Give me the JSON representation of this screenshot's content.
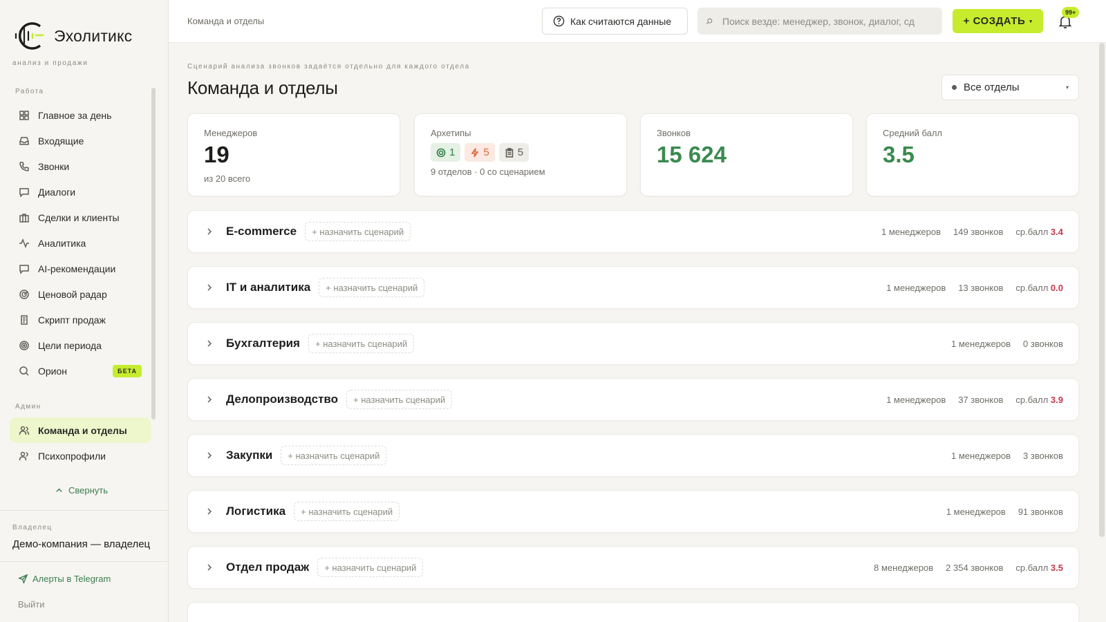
{
  "app": {
    "name": "Эхолитикс",
    "tagline": "анализ и продажи",
    "colors": {
      "accent": "#c6ec2d",
      "green": "#3a8a4f",
      "score_red": "#c8364b"
    }
  },
  "sidebar": {
    "work_label": "Работа",
    "work_items": [
      {
        "label": "Главное за день",
        "icon": "dashboard-icon"
      },
      {
        "label": "Входящие",
        "icon": "inbox-icon"
      },
      {
        "label": "Звонки",
        "icon": "phone-icon"
      },
      {
        "label": "Диалоги",
        "icon": "chat-icon"
      },
      {
        "label": "Сделки и клиенты",
        "icon": "briefcase-icon"
      },
      {
        "label": "Аналитика",
        "icon": "activity-icon"
      },
      {
        "label": "AI-рекомендации",
        "icon": "message-icon"
      },
      {
        "label": "Ценовой радар",
        "icon": "radar-icon"
      },
      {
        "label": "Скрипт продаж",
        "icon": "script-icon"
      },
      {
        "label": "Цели периода",
        "icon": "target-icon"
      },
      {
        "label": "Орион",
        "icon": "search-icon",
        "badge": "БЕТА"
      }
    ],
    "admin_label": "Админ",
    "admin_items": [
      {
        "label": "Команда и отделы",
        "icon": "users-icon",
        "active": true
      },
      {
        "label": "Психопрофили",
        "icon": "user-profile-icon"
      }
    ],
    "collapse_label": "Свернуть",
    "owner_label": "Владелец",
    "owner_name": "Демо-компания — владелец",
    "telegram_label": "Алерты в Telegram",
    "logout_label": "Выйти"
  },
  "topbar": {
    "breadcrumb": "Команда и отделы",
    "help_label": "Как считаются данные",
    "search_placeholder": "Поиск везде: менеджер, звонок, диалог, сд",
    "create_label": "+ СОЗДАТЬ",
    "notifications_badge": "99+"
  },
  "page": {
    "subtitle": "Сценарий анализа звонков задаётся отдельно для каждого отдела",
    "title": "Команда и отделы",
    "filter_value": "Все отделы"
  },
  "stats": {
    "managers": {
      "label": "Менеджеров",
      "value": "19",
      "note": "из 20 всего"
    },
    "archetypes": {
      "label": "Архетипы",
      "chip1": "1",
      "chip2": "5",
      "chip3": "5",
      "note": "9 отделов · 0 со сценарием"
    },
    "calls": {
      "label": "Звонков",
      "value": "15 624"
    },
    "avg_score": {
      "label": "Средний балл",
      "value": "3.5"
    }
  },
  "departments": [
    {
      "name": "E-commerce",
      "assign": "+ назначить сценарий",
      "managers": "1 менеджеров",
      "calls": "149 звонков",
      "score_label": "ср.балл",
      "score": "3.4"
    },
    {
      "name": "IT и аналитика",
      "assign": "+ назначить сценарий",
      "managers": "1 менеджеров",
      "calls": "13 звонков",
      "score_label": "ср.балл",
      "score": "0.0"
    },
    {
      "name": "Бухгалтерия",
      "assign": "+ назначить сценарий",
      "managers": "1 менеджеров",
      "calls": "0 звонков"
    },
    {
      "name": "Делопроизводство",
      "assign": "+ назначить сценарий",
      "managers": "1 менеджеров",
      "calls": "37 звонков",
      "score_label": "ср.балл",
      "score": "3.9"
    },
    {
      "name": "Закупки",
      "assign": "+ назначить сценарий",
      "managers": "1 менеджеров",
      "calls": "3 звонков"
    },
    {
      "name": "Логистика",
      "assign": "+ назначить сценарий",
      "managers": "1 менеджеров",
      "calls": "91 звонков"
    },
    {
      "name": "Отдел продаж",
      "assign": "+ назначить сценарий",
      "managers": "8 менеджеров",
      "calls": "2 354 звонков",
      "score_label": "ср.балл",
      "score": "3.5"
    }
  ]
}
